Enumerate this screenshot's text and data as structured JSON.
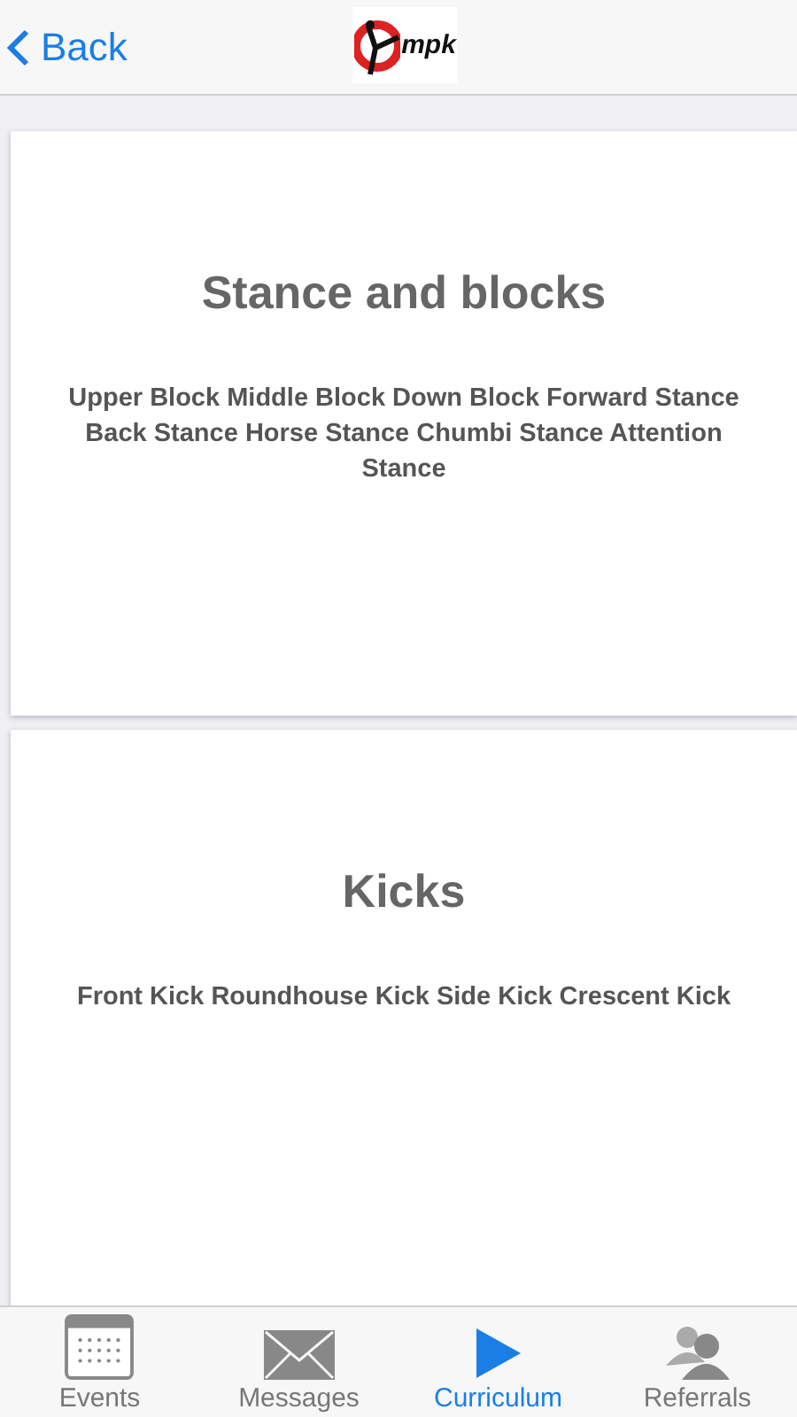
{
  "header": {
    "back": "Back",
    "logo_text": "mpk"
  },
  "cards": [
    {
      "title": "Stance and blocks",
      "body": "Upper Block Middle Block Down Block Forward Stance Back Stance Horse Stance Chumbi Stance Attention Stance"
    },
    {
      "title": "Kicks",
      "body": "Front Kick Roundhouse Kick Side Kick Crescent Kick"
    }
  ],
  "tabs": [
    {
      "kind": "calendar",
      "label": "Events",
      "selected": false
    },
    {
      "kind": "mail",
      "label": "Messages",
      "selected": false
    },
    {
      "kind": "play",
      "label": "Curriculum",
      "selected": true
    },
    {
      "kind": "people",
      "label": "Referrals",
      "selected": false
    }
  ]
}
